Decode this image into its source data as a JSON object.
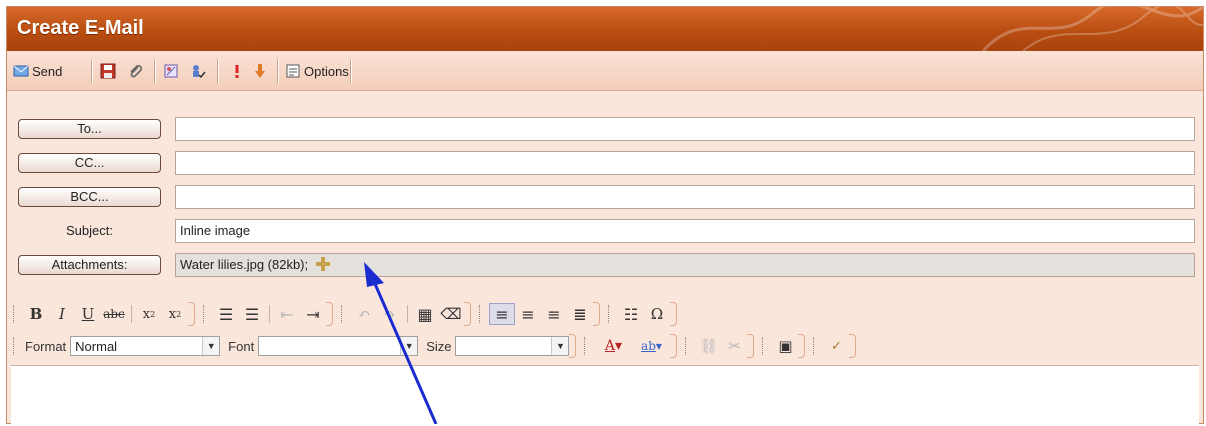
{
  "window": {
    "title": "Create E-Mail"
  },
  "toolbar": {
    "send_label": "Send",
    "options_label": "Options"
  },
  "form": {
    "to_button": "To...",
    "cc_button": "CC...",
    "bcc_button": "BCC...",
    "subject_label": "Subject:",
    "subject_value": "Inline image",
    "attachments_button": "Attachments:",
    "attachments_value": "Water lilies.jpg (82kb);",
    "to_value": ""
  },
  "editor": {
    "format_label": "Format",
    "format_value": "Normal",
    "font_label": "Font",
    "font_value": "",
    "size_label": "Size",
    "size_value": ""
  },
  "colors": {
    "accent": "#b94e12",
    "annotation_arrow": "#1a2ccf"
  }
}
